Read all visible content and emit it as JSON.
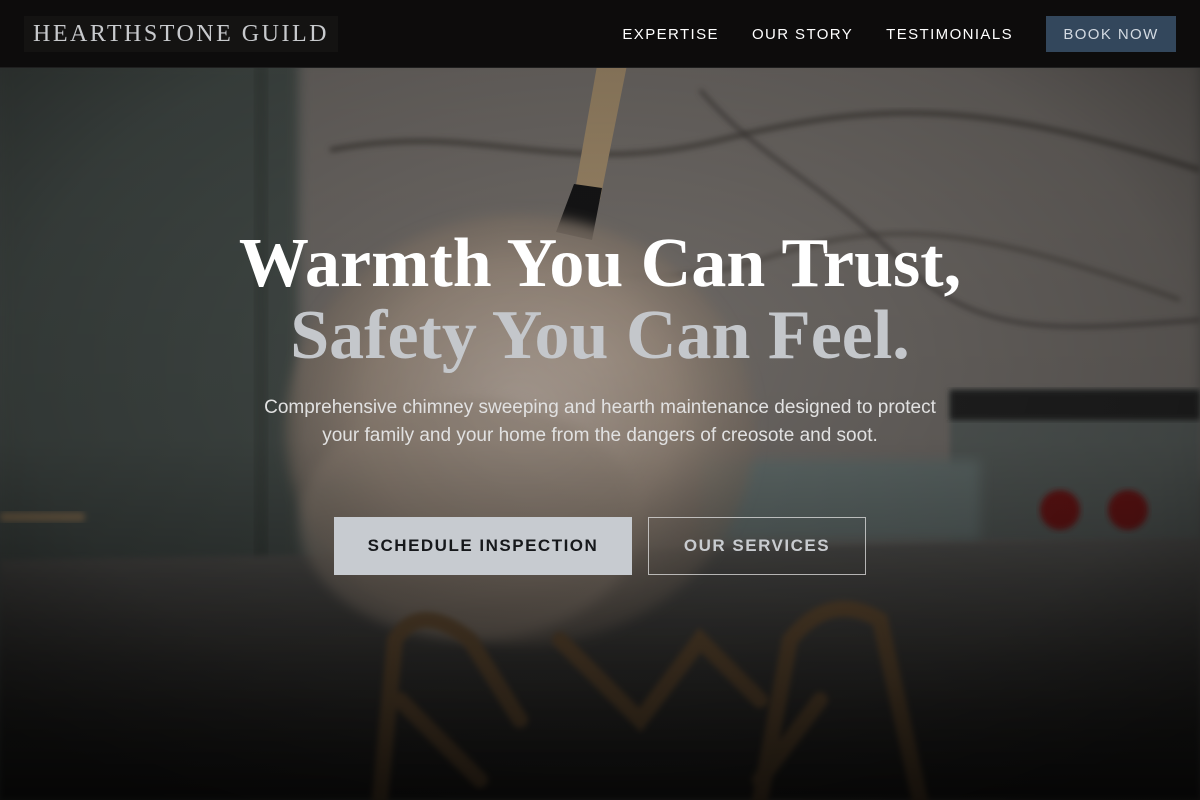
{
  "header": {
    "logo": "HEARTHSTONE GUILD",
    "nav": [
      {
        "label": "EXPERTISE"
      },
      {
        "label": "OUR STORY"
      },
      {
        "label": "TESTIMONIALS"
      }
    ],
    "cta_label": "BOOK NOW"
  },
  "hero": {
    "headline_line1": "Warmth You Can Trust,",
    "headline_line2": "Safety You Can Feel.",
    "subheading": "Comprehensive chimney sweeping and hearth maintenance designed to protect your family and your home from the dangers of creosote and soot.",
    "primary_button": "SCHEDULE INSPECTION",
    "secondary_button": "OUR SERVICES"
  },
  "colors": {
    "header_bg": "#0d0c0c",
    "accent_button": "#33475c",
    "primary_button_bg": "#c7cbd0",
    "headline_secondary": "#c4c7cb"
  }
}
